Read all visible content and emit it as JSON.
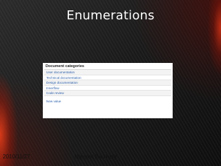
{
  "slide": {
    "title": "Enumerations",
    "footer_date": "2010/11/27",
    "footer_author": "Nguyen Ba Hung"
  },
  "panel": {
    "header": "Document categories",
    "rows": [
      {
        "label": "User documentation"
      },
      {
        "label": "Technical documentation"
      },
      {
        "label": "Design documentation"
      },
      {
        "label": "Innerflow"
      },
      {
        "label": "Code review"
      }
    ],
    "new_value_label": "New value"
  },
  "colors": {
    "link": "#2a5ea8",
    "title_text": "#ffffff",
    "accent_glow": "#e13c19"
  }
}
